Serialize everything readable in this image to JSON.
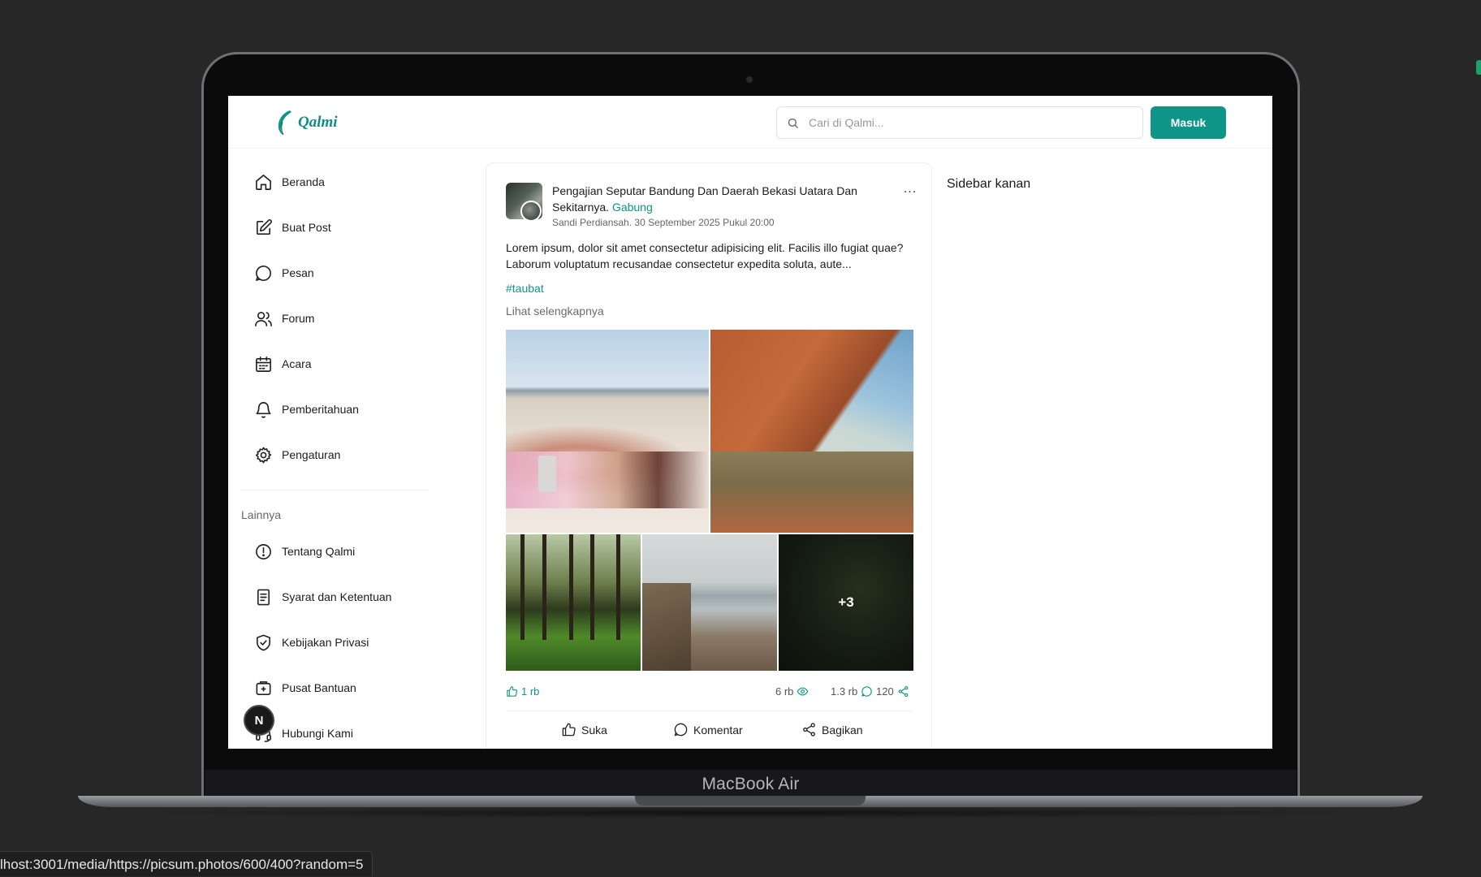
{
  "app": {
    "name": "Qalmi",
    "brand_color": "#0f9488"
  },
  "header": {
    "search_placeholder": "Cari di Qalmi...",
    "login_label": "Masuk"
  },
  "sidebar": {
    "main_items": [
      {
        "label": "Beranda",
        "icon": "home-icon"
      },
      {
        "label": "Buat Post",
        "icon": "edit-icon"
      },
      {
        "label": "Pesan",
        "icon": "message-icon"
      },
      {
        "label": "Forum",
        "icon": "users-icon"
      },
      {
        "label": "Acara",
        "icon": "calendar-icon"
      },
      {
        "label": "Pemberitahuan",
        "icon": "bell-icon"
      },
      {
        "label": "Pengaturan",
        "icon": "gear-icon"
      }
    ],
    "section_label": "Lainnya",
    "other_items": [
      {
        "label": "Tentang Qalmi",
        "icon": "info-icon"
      },
      {
        "label": "Syarat dan Ketentuan",
        "icon": "document-icon"
      },
      {
        "label": "Kebijakan Privasi",
        "icon": "shield-icon"
      },
      {
        "label": "Pusat Bantuan",
        "icon": "help-icon"
      },
      {
        "label": "Hubungi Kami",
        "icon": "headset-icon"
      }
    ]
  },
  "post": {
    "title": "Pengajian Seputar Bandung Dan Daerah Bekasi Uatara Dan Sekitarnya.",
    "join_label": "Gabung",
    "author": "Sandi Perdiansah.",
    "date": "30 September 2025 Pukul 20:00",
    "more_label": "...",
    "body": "Lorem ipsum, dolor sit amet consectetur adipisicing elit. Facilis illo fugiat quae? Laborum voluptatum recusandae consectetur expedita soluta, aute...",
    "hashtag": "#taubat",
    "see_more": "Lihat selengkapnya",
    "extra_images": "+3",
    "stats": {
      "likes": "1 rb",
      "views": "6 rb",
      "comments": "1.3 rb",
      "shares": "120"
    },
    "actions": {
      "like": "Suka",
      "comment": "Komentar",
      "share": "Bagikan"
    }
  },
  "right_sidebar": {
    "title": "Sidebar kanan"
  },
  "device": {
    "label": "MacBook Air"
  },
  "dev_badge": {
    "label": "N"
  },
  "browser_status": {
    "url": "lhost:3001/media/https://picsum.photos/600/400?random=5"
  }
}
